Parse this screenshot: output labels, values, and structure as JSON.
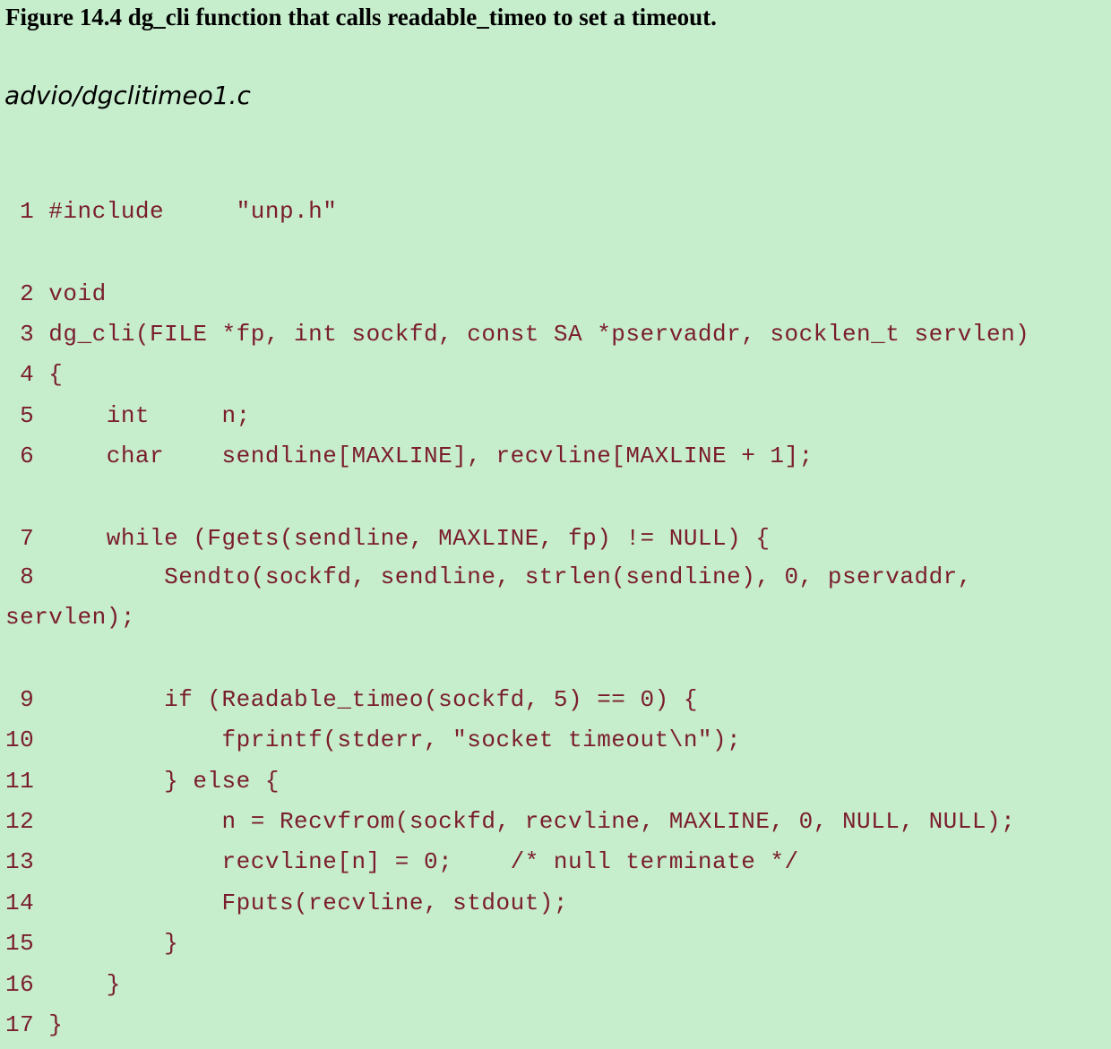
{
  "caption": "Figure 14.4 dg_cli function that calls readable_timeo to set a timeout.",
  "filename": "advio/dgclitimeo1.c",
  "code_lines": [
    " 1 #include     \"unp.h\"",
    " 2 void",
    " 3 dg_cli(FILE *fp, int sockfd, const SA *pservaddr, socklen_t servlen)",
    " 4 {",
    " 5     int     n;",
    " 6     char    sendline[MAXLINE], recvline[MAXLINE + 1];",
    " 7     while (Fgets(sendline, MAXLINE, fp) != NULL) {",
    " 8         Sendto(sockfd, sendline, strlen(sendline), 0, pservaddr,",
    "servlen);",
    " 9         if (Readable_timeo(sockfd, 5) == 0) {",
    "10             fprintf(stderr, \"socket timeout\\n\");",
    "11         } else {",
    "12             n = Recvfrom(sockfd, recvline, MAXLINE, 0, NULL, NULL);",
    "13             recvline[n] = 0;    /* null terminate */",
    "14             Fputs(recvline, stdout);",
    "15         }",
    "16     }",
    "17 }"
  ]
}
